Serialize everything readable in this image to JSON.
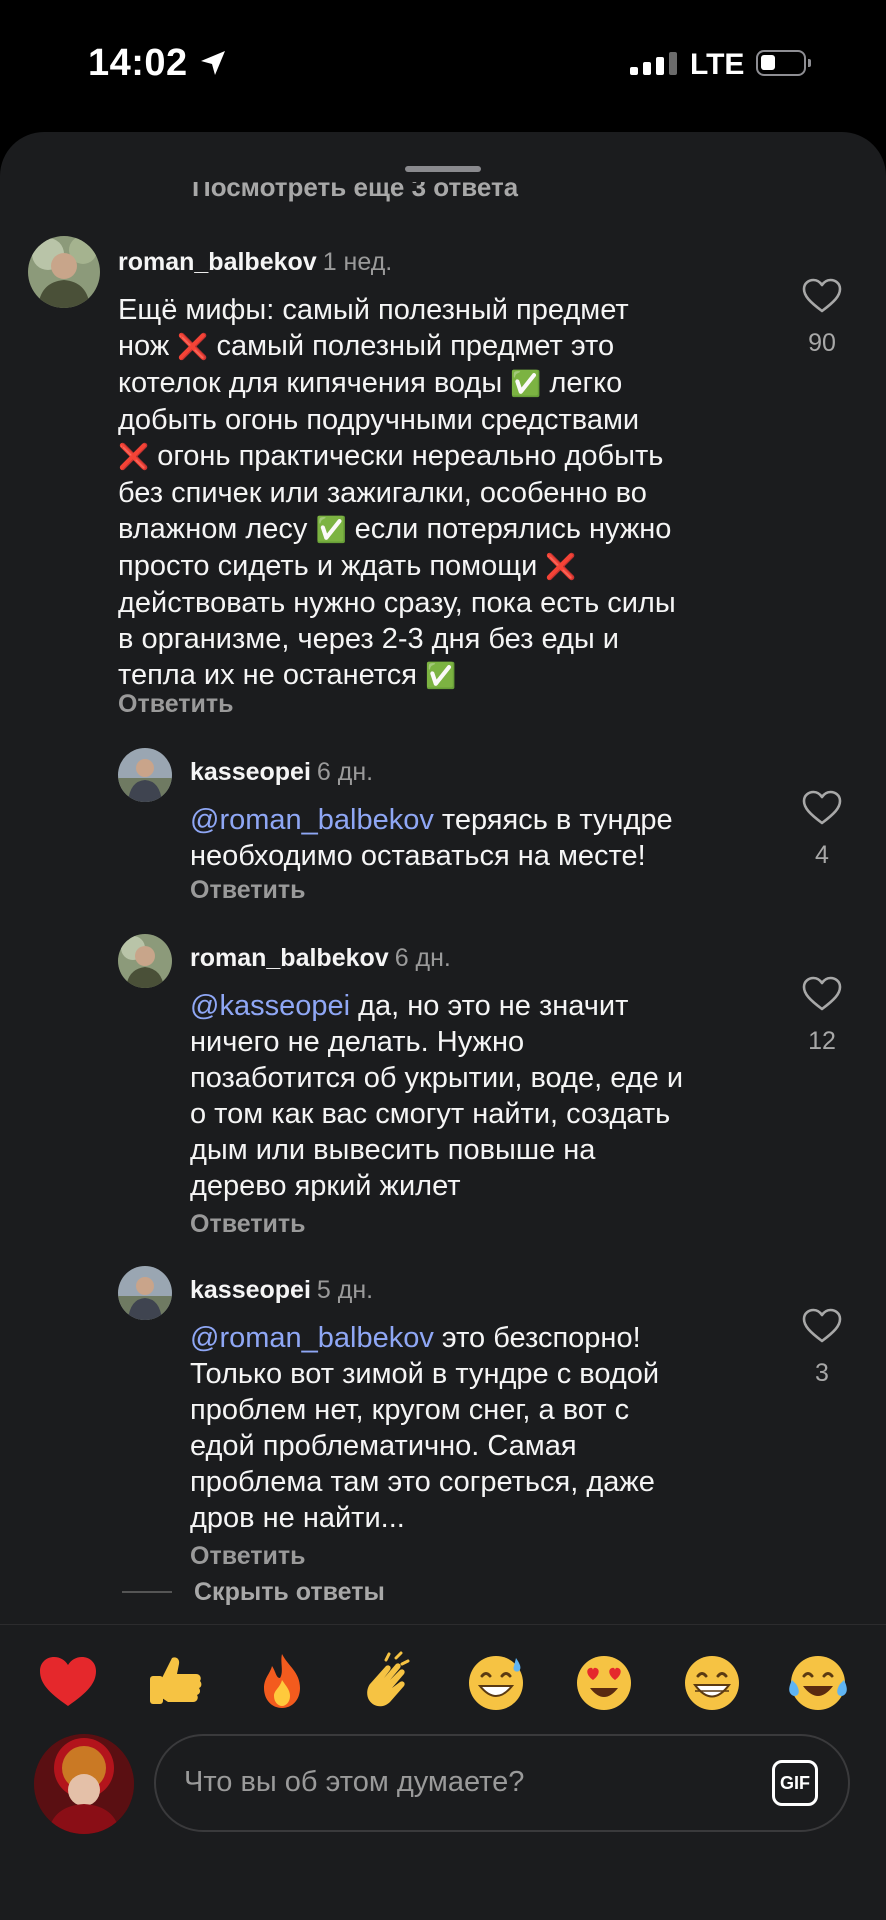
{
  "status": {
    "time": "14:02",
    "network": "LTE"
  },
  "thread": {
    "view_more_label": "Посмотреть ещё 3 ответа",
    "hide_replies_label": "Скрыть ответы",
    "reply_label": "Ответить",
    "comments": [
      {
        "username": "roman_balbekov",
        "when": "1 нед.",
        "likes": "90",
        "lines": [
          [
            "Ещё мифы: самый полезный предмет"
          ],
          [
            "нож ",
            "❌",
            " самый полезный предмет это"
          ],
          [
            "котелок для кипячения воды ",
            "✅",
            " легко"
          ],
          [
            "добыть огонь подручными средствами"
          ],
          [
            "❌",
            " огонь практически нереально добыть"
          ],
          [
            "без спичек или зажигалки, особенно во"
          ],
          [
            "влажном лесу ",
            "✅",
            " если потерялись нужно"
          ],
          [
            "просто сидеть и ждать помощи ",
            "❌"
          ],
          [
            "действовать нужно сразу, пока есть силы"
          ],
          [
            "в организме, через 2-3 дня без еды и"
          ],
          [
            "тепла их не останется ",
            "✅"
          ]
        ]
      },
      {
        "username": "kasseopei",
        "when": "6 дн.",
        "likes": "4",
        "mention": "@roman_balbekov",
        "text_after_mention": " теряясь в тундре",
        "rest_lines": [
          "необходимо оставаться на месте!"
        ]
      },
      {
        "username": "roman_balbekov",
        "when": "6 дн.",
        "likes": "12",
        "mention": "@kasseopei",
        "text_after_mention": " да, но это не значит",
        "rest_lines": [
          "ничего не делать. Нужно",
          "позаботится об укрытии, воде, еде и",
          "о том как вас смогут найти, создать",
          "дым или вывесить повыше на",
          "дерево яркий жилет"
        ]
      },
      {
        "username": "kasseopei",
        "when": "5 дн.",
        "likes": "3",
        "mention": "@roman_balbekov",
        "text_after_mention": " это безспорно!",
        "rest_lines": [
          "Только вот зимой в тундре с водой",
          "проблем нет, кругом снег, а вот с",
          "едой проблематично. Самая",
          "проблема там это согреться, даже",
          "дров не найти..."
        ]
      }
    ]
  },
  "reactions": [
    "heart",
    "thumbs-up",
    "fire",
    "clapping-hands",
    "grinning-sweat",
    "heart-eyes",
    "beaming-smile",
    "tears-of-joy"
  ],
  "composer": {
    "placeholder": "Что вы об этом думаете?",
    "gif_label": "GIF"
  },
  "colors": {
    "sheet_bg": "#1b1c1e",
    "mention": "#8fa7f5",
    "muted": "#9a9a9a"
  }
}
